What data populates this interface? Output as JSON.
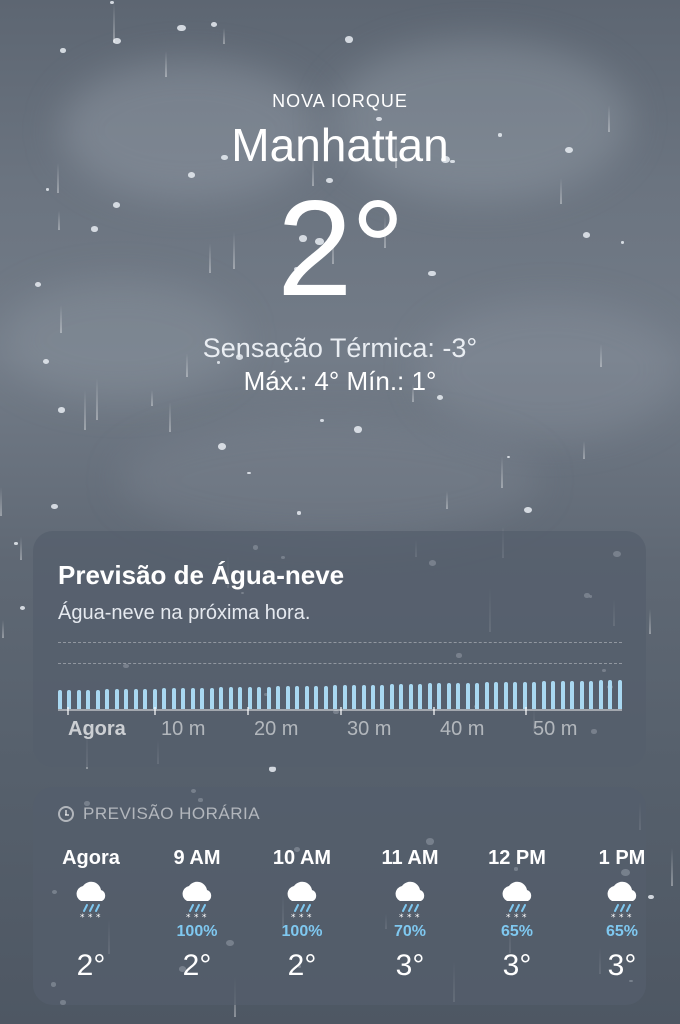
{
  "location": {
    "region": "NOVA IORQUE",
    "city": "Manhattan"
  },
  "current": {
    "temp": "2°",
    "feels_like": "Sensação Térmica: -3°",
    "hi_lo": "Máx.: 4°  Mín.: 1°"
  },
  "sleet_card": {
    "title": "Previsão de Água-neve",
    "subtitle": "Água-neve na próxima hora.",
    "x_labels": [
      "Agora",
      "10 m",
      "20 m",
      "30 m",
      "40 m",
      "50 m"
    ],
    "intensity": [
      0.55,
      0.56,
      0.56,
      0.57,
      0.57,
      0.58,
      0.58,
      0.59,
      0.59,
      0.6,
      0.6,
      0.61,
      0.61,
      0.62,
      0.62,
      0.63,
      0.63,
      0.64,
      0.64,
      0.65,
      0.65,
      0.66,
      0.66,
      0.67,
      0.67,
      0.68,
      0.68,
      0.69,
      0.69,
      0.7,
      0.7,
      0.71,
      0.71,
      0.72,
      0.72,
      0.73,
      0.73,
      0.74,
      0.74,
      0.75,
      0.75,
      0.76,
      0.76,
      0.77,
      0.77,
      0.78,
      0.78,
      0.79,
      0.79,
      0.8,
      0.8,
      0.81,
      0.81,
      0.82,
      0.82,
      0.83,
      0.83,
      0.84,
      0.84,
      0.85
    ]
  },
  "hourly": {
    "heading": "PREVISÃO HORÁRIA",
    "hours": [
      {
        "label": "Agora",
        "icon": "sleet-cloud-icon",
        "pct": "",
        "temp": "2°"
      },
      {
        "label": "9 AM",
        "icon": "sleet-cloud-icon",
        "pct": "100%",
        "temp": "2°"
      },
      {
        "label": "10 AM",
        "icon": "sleet-cloud-icon",
        "pct": "100%",
        "temp": "2°"
      },
      {
        "label": "11 AM",
        "icon": "sleet-cloud-icon",
        "pct": "70%",
        "temp": "3°"
      },
      {
        "label": "12 PM",
        "icon": "sleet-cloud-icon",
        "pct": "65%",
        "temp": "3°"
      },
      {
        "label": "1 PM",
        "icon": "sleet-cloud-icon",
        "pct": "65%",
        "temp": "3°"
      }
    ]
  },
  "colors": {
    "precip": "#7fc8f0",
    "bar": "#a9d8f1"
  }
}
